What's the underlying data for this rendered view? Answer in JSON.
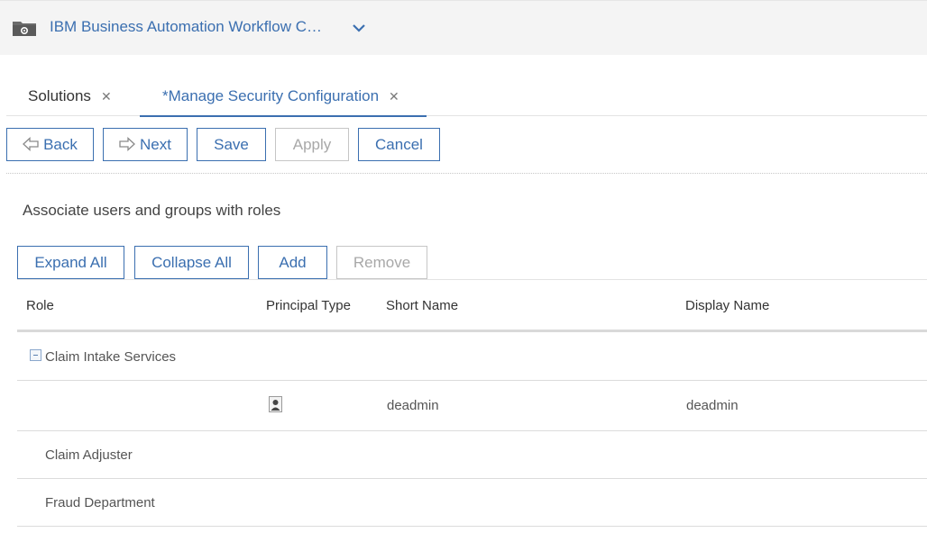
{
  "header": {
    "app_title": "IBM Business Automation Workflow C…",
    "app_icon": "folder-gear-icon",
    "menu_icon": "chevron-down-icon"
  },
  "tabs": [
    {
      "label": "Solutions",
      "close": "✕",
      "active": false
    },
    {
      "label": "*Manage Security Configuration",
      "close": "✕",
      "active": true
    }
  ],
  "toolbar": {
    "back": "Back",
    "next": "Next",
    "save": "Save",
    "apply": "Apply",
    "cancel": "Cancel"
  },
  "main": {
    "instruction": "Associate users and groups with roles",
    "actions": {
      "expand_all": "Expand All",
      "collapse_all": "Collapse All",
      "add": "Add",
      "remove": "Remove"
    }
  },
  "table": {
    "columns": [
      "Role",
      "Principal Type",
      "Short Name",
      "Display Name"
    ],
    "rows": [
      {
        "role": "Claim Intake Services",
        "principal_type": "",
        "short_name": "",
        "display_name": "",
        "expanded": true
      },
      {
        "role": "",
        "principal_type": "user-icon",
        "short_name": "deadmin",
        "display_name": "deadmin"
      },
      {
        "role": "Claim Adjuster",
        "principal_type": "",
        "short_name": "",
        "display_name": ""
      },
      {
        "role": "Fraud Department",
        "principal_type": "",
        "short_name": "",
        "display_name": ""
      }
    ]
  },
  "colors": {
    "accent": "#3b6fb0",
    "disabled": "#a8a8a8",
    "header_bg": "#f4f4f4"
  }
}
